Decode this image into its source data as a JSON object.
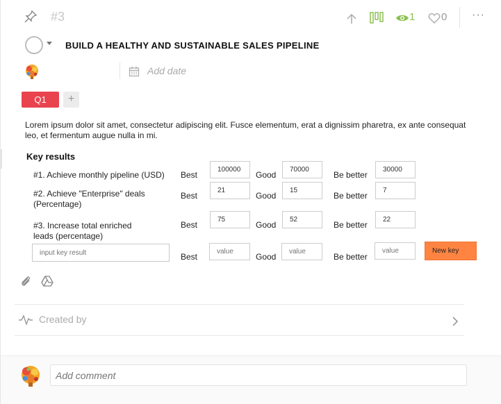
{
  "header": {
    "task_number": "#3",
    "eye_count": "1",
    "heart_count": "0",
    "more_label": "···"
  },
  "task": {
    "title": "BUILD A HEALTHY AND SUSTAINABLE SALES PIPELINE",
    "add_date_placeholder": "Add date",
    "tags": [
      "Q1"
    ],
    "add_tag_label": "+",
    "description": "Lorem ipsum dolor sit amet, consectetur adipiscing elit. Fusce elementum, erat a dignissim pharetra, ex ante consequat leo, et fermentum augue nulla in mi."
  },
  "key_results": {
    "heading": "Key results",
    "levels": {
      "best": "Best",
      "good": "Good",
      "better": "Be better"
    },
    "items": [
      {
        "label": "#1. Achieve monthly pipeline (USD)",
        "best": "100000",
        "good": "70000",
        "better": "30000"
      },
      {
        "label": "#2. Achieve \"Enterprise\" deals (Percentage)",
        "best": "21",
        "good": "15",
        "better": "7"
      },
      {
        "label": "#3. Increase total enriched leads (percentage)",
        "best": "75",
        "good": "52",
        "better": "22"
      }
    ],
    "new_row": {
      "input_placeholder": "input key result",
      "value_placeholder": "value",
      "button_label": "New key"
    }
  },
  "activity": {
    "created_by_label": "Created by"
  },
  "comment": {
    "placeholder": "Add comment"
  },
  "colors": {
    "accent_green": "#8cc152",
    "tag_red": "#e9434e",
    "new_key_orange": "#ff8442"
  }
}
